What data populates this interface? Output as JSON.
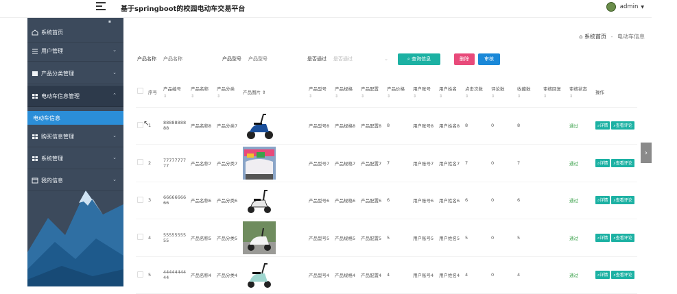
{
  "header": {
    "title": "基于springboot的校园电动车交易平台",
    "user": "admin"
  },
  "sidebar": {
    "items": [
      {
        "label": "系统首页",
        "icon": "home-icon"
      },
      {
        "label": "用户管理",
        "icon": "sliders-icon"
      },
      {
        "label": "产品分类管理",
        "icon": "image-icon"
      },
      {
        "label": "电动车信息管理",
        "icon": "grid-icon"
      },
      {
        "label": "购买信息管理",
        "icon": "grid-icon"
      },
      {
        "label": "系统管理",
        "icon": "grid-icon"
      },
      {
        "label": "我的信息",
        "icon": "window-icon"
      }
    ],
    "active_sub": "电动车信息"
  },
  "breadcrumb": {
    "home": "系统首页",
    "separator": "-",
    "current": "电动车信息"
  },
  "filters": {
    "name_label": "产品名称",
    "name_placeholder": "产品名称",
    "model_label": "产品型号",
    "model_placeholder": "产品型号",
    "pass_label": "是否通过",
    "pass_placeholder": "是否通过",
    "search_button": "查询信息",
    "delete_button": "删除",
    "audit_button": "审核"
  },
  "table": {
    "headers": [
      "序号",
      "产品编号",
      "产品名称",
      "产品分类",
      "产品图片",
      "产品型号",
      "产品规格",
      "产品配置",
      "产品价格",
      "用户账号",
      "用户姓名",
      "点击次数",
      "评论数",
      "收藏数",
      "审核回复",
      "审核状态",
      "操作"
    ],
    "rows": [
      {
        "idx": "1",
        "code": "8888888888",
        "name": "产品名称8",
        "cat": "产品分类7",
        "model": "产品型号8",
        "spec": "产品规格8",
        "conf": "产品配置8",
        "price": "8",
        "acct": "用户账号8",
        "uname": "用户姓名8",
        "clicks": "8",
        "comments": "0",
        "favs": "8",
        "reply": "",
        "status": "通过",
        "img": "scooter-blue"
      },
      {
        "idx": "2",
        "code": "7777777777",
        "name": "产品名称7",
        "cat": "产品分类7",
        "model": "产品型号7",
        "spec": "产品规格7",
        "conf": "产品配置7",
        "price": "7",
        "acct": "用户账号7",
        "uname": "用户姓名7",
        "clicks": "7",
        "comments": "0",
        "favs": "7",
        "reply": "",
        "status": "通过",
        "img": "scooter-colorful"
      },
      {
        "idx": "3",
        "code": "6666666666",
        "name": "产品名称6",
        "cat": "产品分类6",
        "model": "产品型号6",
        "spec": "产品规格6",
        "conf": "产品配置6",
        "price": "6",
        "acct": "用户账号6",
        "uname": "用户姓名6",
        "clicks": "6",
        "comments": "0",
        "favs": "6",
        "reply": "",
        "status": "通过",
        "img": "scooter-white"
      },
      {
        "idx": "4",
        "code": "5555555555",
        "name": "产品名称5",
        "cat": "产品分类5",
        "model": "产品型号5",
        "spec": "产品规格5",
        "conf": "产品配置5",
        "price": "5",
        "acct": "用户账号5",
        "uname": "用户姓名5",
        "clicks": "5",
        "comments": "0",
        "favs": "5",
        "reply": "",
        "status": "通过",
        "img": "scooter-outdoor"
      },
      {
        "idx": "5",
        "code": "4444444444",
        "name": "产品名称4",
        "cat": "产品分类4",
        "model": "产品型号4",
        "spec": "产品规格4",
        "conf": "产品配置4",
        "price": "4",
        "acct": "用户账号4",
        "uname": "用户姓名4",
        "clicks": "4",
        "comments": "0",
        "favs": "4",
        "reply": "",
        "status": "通过",
        "img": "scooter-teal"
      }
    ],
    "op_detail": "详情",
    "op_comment": "查看评论",
    "sort_glyph": "⇕"
  },
  "colors": {
    "sidebar_bg": "#3c4a5c",
    "sidebar_active": "#2b8ed8",
    "btn_search": "#1cb1a3",
    "btn_delete": "#e84a7a",
    "btn_audit": "#1a88d8",
    "status_pass": "#3aa14a"
  }
}
